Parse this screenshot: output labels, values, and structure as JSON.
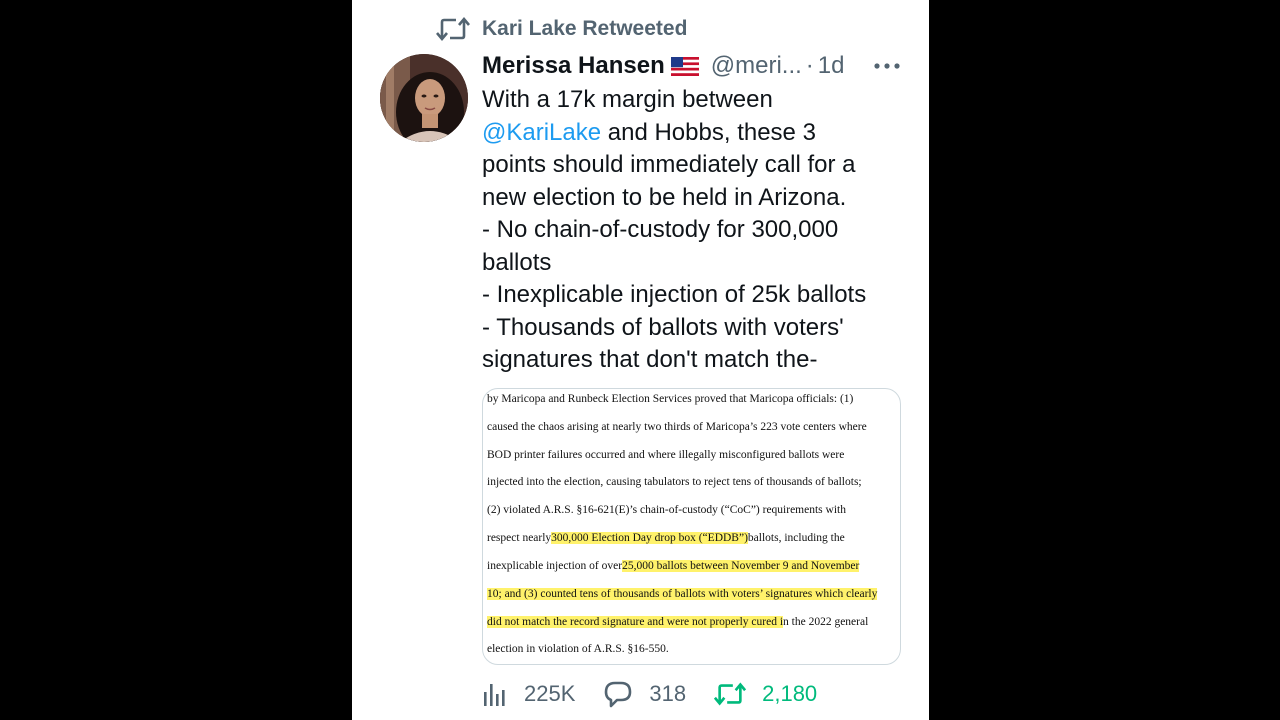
{
  "retweet_banner": {
    "text": "Kari Lake Retweeted",
    "icon": "retweet-icon"
  },
  "tweet": {
    "author_name": "Merissa Hansen",
    "flag": "🇺🇸",
    "handle": "@meri...",
    "separator": "·",
    "time": "1d",
    "text_lines": [
      "With a 17k margin between",
      "and Hobbs, these 3",
      "points should immediately call for a",
      "new election to be held in Arizona.",
      "- No chain-of-custody for 300,000",
      "ballots",
      "- Inexplicable injection of 25k ballots",
      "- Thousands of ballots with voters'",
      "signatures that don't match the-"
    ],
    "mention": "@KariLake"
  },
  "document": {
    "lines": [
      {
        "parts": [
          "by Maricopa and Runbeck Election Services proved that Maricopa officials: (1)"
        ]
      },
      {
        "parts": [
          "caused the chaos arising at nearly two thirds of Maricopa’s 223 vote centers where"
        ]
      },
      {
        "parts": [
          "BOD printer failures occurred and where illegally misconfigured ballots were"
        ]
      },
      {
        "parts": [
          "injected into the election, causing tabulators to reject tens of thousands of ballots;"
        ]
      },
      {
        "parts": [
          "(2) violated A.R.S. §16-621(E)’s chain-of-custody (“CoC”) requirements with"
        ]
      },
      {
        "pre": "respect nearly",
        "hl": " 300,000 Election Day drop box (“EDDB”)",
        "post": " ballots, including the"
      },
      {
        "pre": "inexplicable injection of over",
        "hl": " 25,000 ballots between November 9 and November",
        "post": ""
      },
      {
        "hl": "10; and (3) counted tens of thousands of ballots with voters’ signatures which clearly",
        "pre": "",
        "post": ""
      },
      {
        "hl": "did not match the record signature and were not properly cured i",
        "post": "n the 2022 general",
        "pre": ""
      },
      {
        "parts": [
          "election in violation of A.R.S. §16-550."
        ]
      }
    ]
  },
  "actions": {
    "views": "225K",
    "replies": "318",
    "retweets": "2,180"
  },
  "colors": {
    "link": "#1d9bf0",
    "muted": "#536471",
    "retweet_green": "#00ba7c",
    "highlight": "#fff26b"
  }
}
